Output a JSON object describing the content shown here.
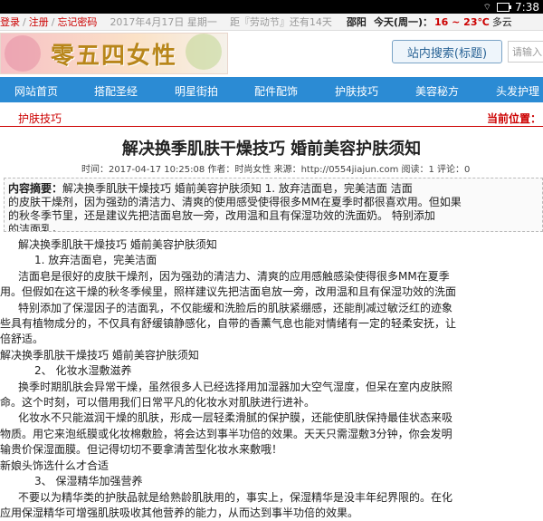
{
  "status_bar": {
    "time": "7:38"
  },
  "top_bar": {
    "login": "登录",
    "register": "注册",
    "forgot": "忘记密码",
    "date": "2017年4月17日 星期一",
    "countdown": "距『劳动节』还有14天",
    "city": "邵阳",
    "today": "今天(周一)：",
    "weather": "16 ~ 23℃",
    "weather_rest": "多云"
  },
  "logo": {
    "text": "零五四女性"
  },
  "search": {
    "button_label": "站内搜索(标题)",
    "placeholder": "请输入"
  },
  "nav": {
    "items": [
      "网站首页",
      "搭配圣经",
      "明星街拍",
      "配件配饰",
      "护肤技巧",
      "美容秘方",
      "头发护理"
    ]
  },
  "breadcrumb": {
    "left": "护肤技巧",
    "right": "当前位置："
  },
  "article": {
    "title": "解决换季肌肤干燥技巧 婚前美容护肤须知",
    "meta": "时间：2017-04-17 10:25:08  作者：时尚女性  来源：http://0554jiajun.com  阅读：1  评论：0",
    "summary_label": "内容摘要：",
    "summary_lines": [
      "解决换季肌肤干燥技巧 婚前美容护肤须知    1. 放弃洁面皂，完美洁面      洁面",
      "的皮肤干燥剂，因为强劲的清洁力、清爽的使用感受使得很多MM在夏季时都很喜欢用。但如果",
      "的秋冬季节里，还是建议先把洁面皂放一旁，改用温和且有保湿功效的洗面奶。      特别添加",
      "的洁面乳，..."
    ],
    "paragraphs": [
      "解决换季肌肤干燥技巧 婚前美容护肤须知",
      "1. 放弃洁面皂，完美洁面",
      "洁面皂是很好的皮肤干燥剂，因为强劲的清洁力、清爽的应用感触感染使得很多MM在夏季",
      "用。但假如在这干燥的秋冬季候里，照样建议先把洁面皂放一旁，改用温和且有保湿功效的洗面",
      "特别添加了保湿因子的洁面乳，不仅能缓和洗脸后的肌肤紧绷感，还能削减过敏泛红的迹象",
      "些具有植物成分的，不仅具有舒缓镇静感化，自带的香薰气息也能对情绪有一定的轻柔安抚，让",
      "倍舒适。",
      "解决换季肌肤干燥技巧 婚前美容护肤须知",
      "2、 化妆水湿敷滋养",
      "换季时期肌肤会异常干燥，虽然很多人已经选择用加湿器加大空气湿度，但呆在室内皮肤照",
      "命。这个时刻，可以借用我们日常平凡的化妆水对肌肤进行进补。",
      "化妆水不只能滋润干燥的肌肤，形成一层轻柔滑腻的保护膜，还能使肌肤保持最佳状态来吸",
      "物质。用它来泡纸膜或化妆棉敷脸，将会达到事半功倍的效果。天天只需湿敷3分钟，你会发明",
      "输贵价保湿面膜。但记得切切不要拿清苦型化妆水来敷哦！",
      "新娘头饰选什么才合适",
      "3、 保湿精华加强营养",
      "不要以为精华类的护肤品就是给熟龄肌肤用的，事实上，保湿精华是没丰年纪界限的。在化",
      "应用保湿精华可增强肌肤吸收其他营养的能力，从而达到事半功倍的效果。"
    ]
  }
}
